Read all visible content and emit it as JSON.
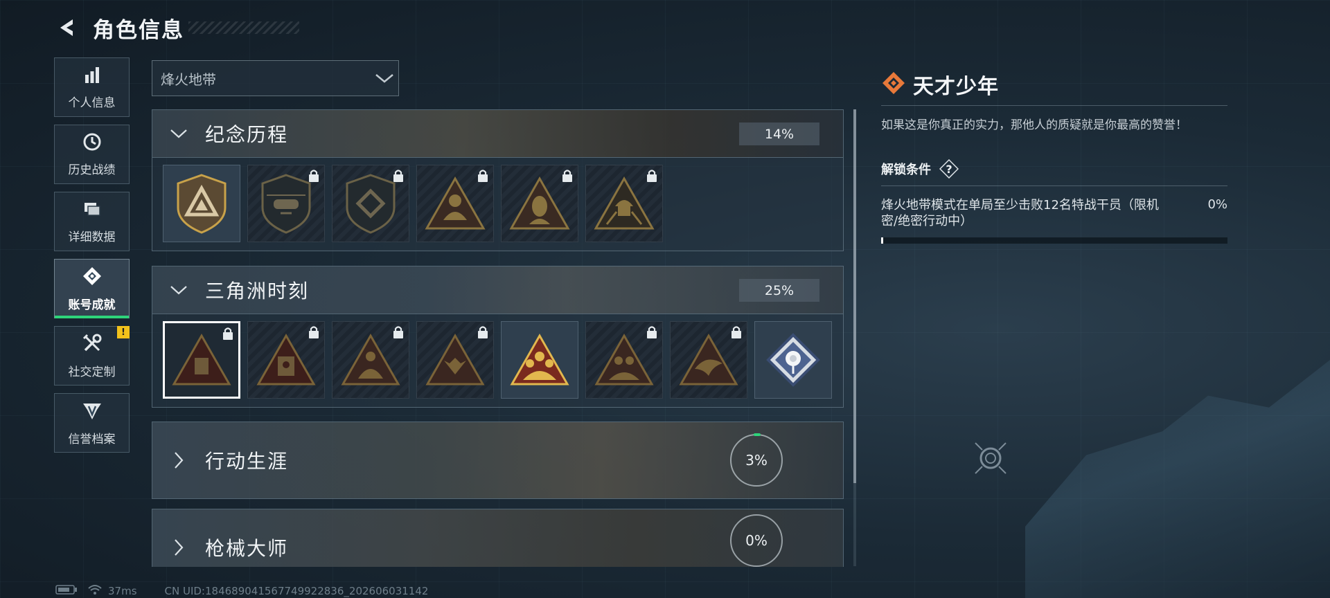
{
  "header": {
    "title": "角色信息"
  },
  "sidebar": {
    "items": [
      {
        "label": "个人信息",
        "icon": "bar-chart-icon"
      },
      {
        "label": "历史战绩",
        "icon": "clock-icon"
      },
      {
        "label": "详细数据",
        "icon": "folders-icon"
      },
      {
        "label": "账号成就",
        "icon": "achievement-diamond-icon",
        "active": true
      },
      {
        "label": "社交定制",
        "icon": "tools-icon",
        "badge": "!"
      },
      {
        "label": "信誉档案",
        "icon": "wing-shield-icon"
      }
    ]
  },
  "mode_select": {
    "value": "烽火地带"
  },
  "categories": [
    {
      "title": "纪念历程",
      "progress": "14%",
      "expanded": true,
      "badges": [
        {
          "name": "triangle-emblem-badge",
          "locked": false
        },
        {
          "name": "helicopter-badge",
          "locked": true
        },
        {
          "name": "diamond-emblem-badge",
          "locked": true
        },
        {
          "name": "soldier-triangle-badge",
          "locked": true
        },
        {
          "name": "operator-portrait-badge",
          "locked": true
        },
        {
          "name": "helmet-soldier-badge",
          "locked": true
        }
      ]
    },
    {
      "title": "三角洲时刻",
      "progress": "25%",
      "expanded": true,
      "badges": [
        {
          "name": "crate-badge",
          "locked": true,
          "selected": true
        },
        {
          "name": "mask-badge",
          "locked": true
        },
        {
          "name": "kneeling-soldier-badge",
          "locked": true
        },
        {
          "name": "fist-badge",
          "locked": true
        },
        {
          "name": "squad-gold-badge",
          "locked": false
        },
        {
          "name": "crew-badge",
          "locked": true
        },
        {
          "name": "bird-badge",
          "locked": true
        },
        {
          "name": "white-rose-badge",
          "locked": false
        }
      ]
    },
    {
      "title": "行动生涯",
      "progress": "3%",
      "expanded": false
    },
    {
      "title": "枪械大师",
      "progress": "0%",
      "expanded": false
    }
  ],
  "detail": {
    "title": "天才少年",
    "description": "如果这是你真正的实力，那他人的质疑就是你最高的赞誉！",
    "unlock_title": "解锁条件",
    "help_label": "?",
    "condition_text": "烽火地带模式在单局至少击败12名特战干员（限机密/绝密行动中）",
    "condition_progress": "0%",
    "condition_fraction": 0
  },
  "footer": {
    "ping": "37ms",
    "uid": "CN UID:18468904156774992​2836_202606031142"
  },
  "colors": {
    "accent_green": "#2ed47a",
    "badge_gold": "#c8a24a",
    "notice_yellow": "#f2c21b",
    "emblem_orange": "#e8793a"
  }
}
